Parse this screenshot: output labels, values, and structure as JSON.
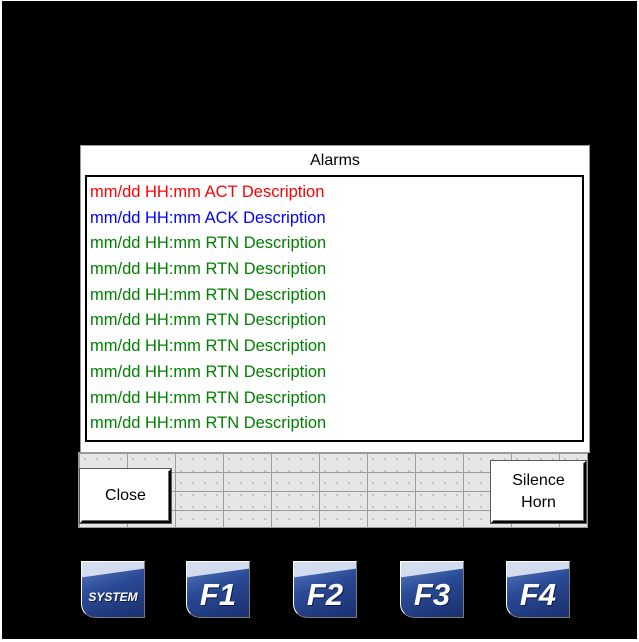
{
  "colors": {
    "active": "#ff0000",
    "acknowledged": "#0000ff",
    "returned": "#008000"
  },
  "alarms": {
    "title": "Alarms",
    "rows": [
      {
        "text": "mm/dd HH:mm ACT Description",
        "status": "active",
        "color": "#ff0000"
      },
      {
        "text": "mm/dd HH:mm ACK Description",
        "status": "acknowledged",
        "color": "#0000ff"
      },
      {
        "text": "mm/dd HH:mm RTN Description",
        "status": "returned",
        "color": "#008000"
      },
      {
        "text": "mm/dd HH:mm RTN Description",
        "status": "returned",
        "color": "#008000"
      },
      {
        "text": "mm/dd HH:mm RTN Description",
        "status": "returned",
        "color": "#008000"
      },
      {
        "text": "mm/dd HH:mm RTN Description",
        "status": "returned",
        "color": "#008000"
      },
      {
        "text": "mm/dd HH:mm RTN Description",
        "status": "returned",
        "color": "#008000"
      },
      {
        "text": "mm/dd HH:mm RTN Description",
        "status": "returned",
        "color": "#008000"
      },
      {
        "text": "mm/dd HH:mm RTN Description",
        "status": "returned",
        "color": "#008000"
      },
      {
        "text": "mm/dd HH:mm RTN Description",
        "status": "returned",
        "color": "#008000"
      }
    ]
  },
  "buttons": {
    "close_label": "Close",
    "silence_line1": "Silence",
    "silence_line2": "Horn"
  },
  "function_keys": {
    "system": "SYSTEM",
    "f1": "F1",
    "f2": "F2",
    "f3": "F3",
    "f4": "F4"
  }
}
